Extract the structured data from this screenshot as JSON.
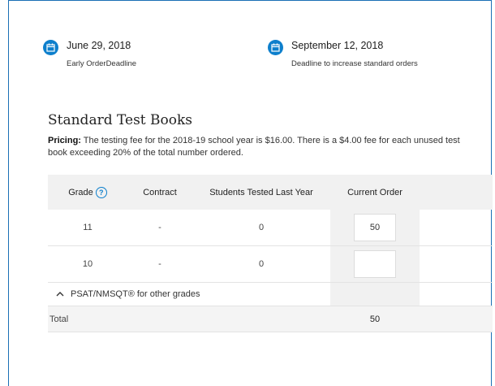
{
  "deadlines": [
    {
      "date": "June 29, 2018",
      "label": "Early OrderDeadline"
    },
    {
      "date": "September 12, 2018",
      "label": "Deadline to increase standard orders"
    }
  ],
  "section": {
    "title": "Standard Test Books",
    "pricing_label": "Pricing:",
    "pricing_text": " The testing fee for the 2018-19 school year is $16.00. There is a $4.00 fee for each unused test book exceeding 20% of the total number ordered."
  },
  "table": {
    "headers": {
      "grade": "Grade",
      "contract": "Contract",
      "students": "Students Tested Last Year",
      "order": "Current Order"
    },
    "rows": [
      {
        "grade": "11",
        "contract": "-",
        "students": "0",
        "order": "50"
      },
      {
        "grade": "10",
        "contract": "-",
        "students": "0",
        "order": ""
      }
    ],
    "other_grades": "PSAT/NMSQT® for other grades",
    "total_label": "Total",
    "total_value": "50"
  },
  "colors": {
    "accent": "#0d7fcc",
    "header_bg": "#f1f1f1"
  }
}
